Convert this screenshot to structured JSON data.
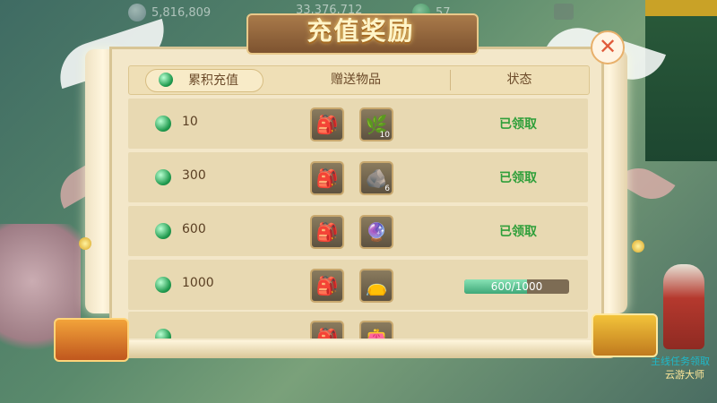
{
  "topbar": {
    "silver": "5,816,809",
    "gold": "33,376,712",
    "jade": "57"
  },
  "dialog": {
    "title": "充值奖励",
    "close_symbol": "✕"
  },
  "table": {
    "headers": [
      "累积充值",
      "赠送物品",
      "状态"
    ],
    "rows": [
      {
        "amount": "10",
        "items": [
          {
            "icon": "treasure-bag-icon",
            "count": ""
          },
          {
            "icon": "herb-bottle-icon",
            "count": "10"
          }
        ],
        "status": "已领取"
      },
      {
        "amount": "300",
        "items": [
          {
            "icon": "treasure-bag-icon",
            "count": ""
          },
          {
            "icon": "dark-ore-icon",
            "count": "6"
          }
        ],
        "status": "已领取"
      },
      {
        "amount": "600",
        "items": [
          {
            "icon": "treasure-bag-icon",
            "count": ""
          },
          {
            "icon": "crystal-orb-icon",
            "count": ""
          }
        ],
        "status": "已领取"
      },
      {
        "amount": "1000",
        "items": [
          {
            "icon": "treasure-bag-icon",
            "count": ""
          },
          {
            "icon": "gift-pouch-icon",
            "count": ""
          }
        ],
        "progress": {
          "current": 600,
          "total": 1000,
          "text": "600/1000"
        }
      },
      {
        "amount": "",
        "items": [
          {
            "icon": "treasure-bag-icon",
            "count": ""
          },
          {
            "icon": "red-pouch-icon",
            "count": ""
          }
        ],
        "status": ""
      }
    ]
  },
  "npc": {
    "label_top": "主线任务领取",
    "label_bottom": "云游大师"
  },
  "colors": {
    "claimed": "#2f9f3a",
    "progress_fill": "#3ea878",
    "title_plate": "#7d5330"
  }
}
